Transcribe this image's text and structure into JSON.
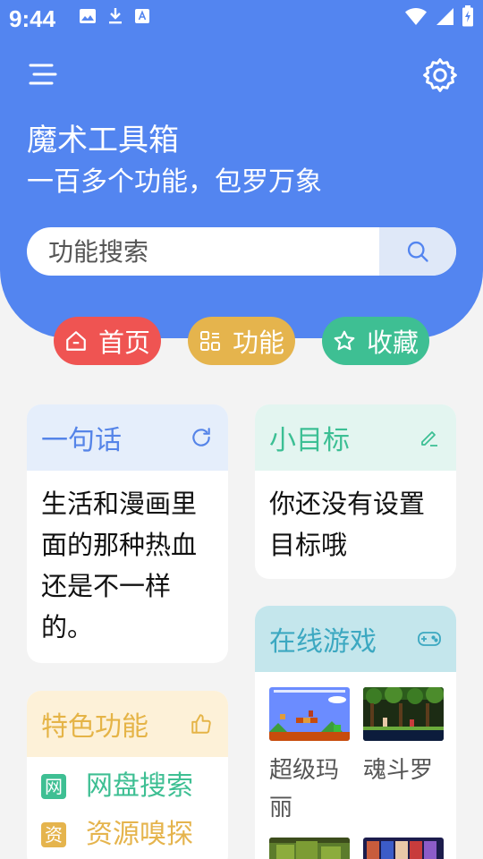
{
  "status_bar": {
    "time": "9:44"
  },
  "header": {
    "title": "魔术工具箱",
    "subtitle": "一百多个功能，包罗万象"
  },
  "search": {
    "placeholder": "功能搜索"
  },
  "tabs": [
    {
      "label": "首页",
      "icon": "home-icon"
    },
    {
      "label": "功能",
      "icon": "grid-icon"
    },
    {
      "label": "收藏",
      "icon": "star-icon"
    }
  ],
  "cards": {
    "quote": {
      "title": "一句话",
      "text": "生活和漫画里面的那种热血还是不一样的。",
      "icon": "refresh-icon"
    },
    "goal": {
      "title": "小目标",
      "text": "你还没有设置目标哦",
      "icon": "edit-icon"
    },
    "feature": {
      "title": "特色功能",
      "icon": "thumbs-up-icon",
      "items": [
        {
          "badge": "网",
          "label": "网盘搜索",
          "color": "#3ebf93"
        },
        {
          "badge": "资",
          "label": "资源嗅探",
          "color": "#e5b44d"
        }
      ]
    },
    "games": {
      "title": "在线游戏",
      "icon": "gamepad-icon",
      "items": [
        {
          "name": "超级玛丽"
        },
        {
          "name": "魂斗罗"
        }
      ]
    }
  },
  "colors": {
    "header": "#5385f0",
    "home_tab": "#ef5452",
    "function_tab": "#e5b44d",
    "favorite_tab": "#3ebf93"
  }
}
